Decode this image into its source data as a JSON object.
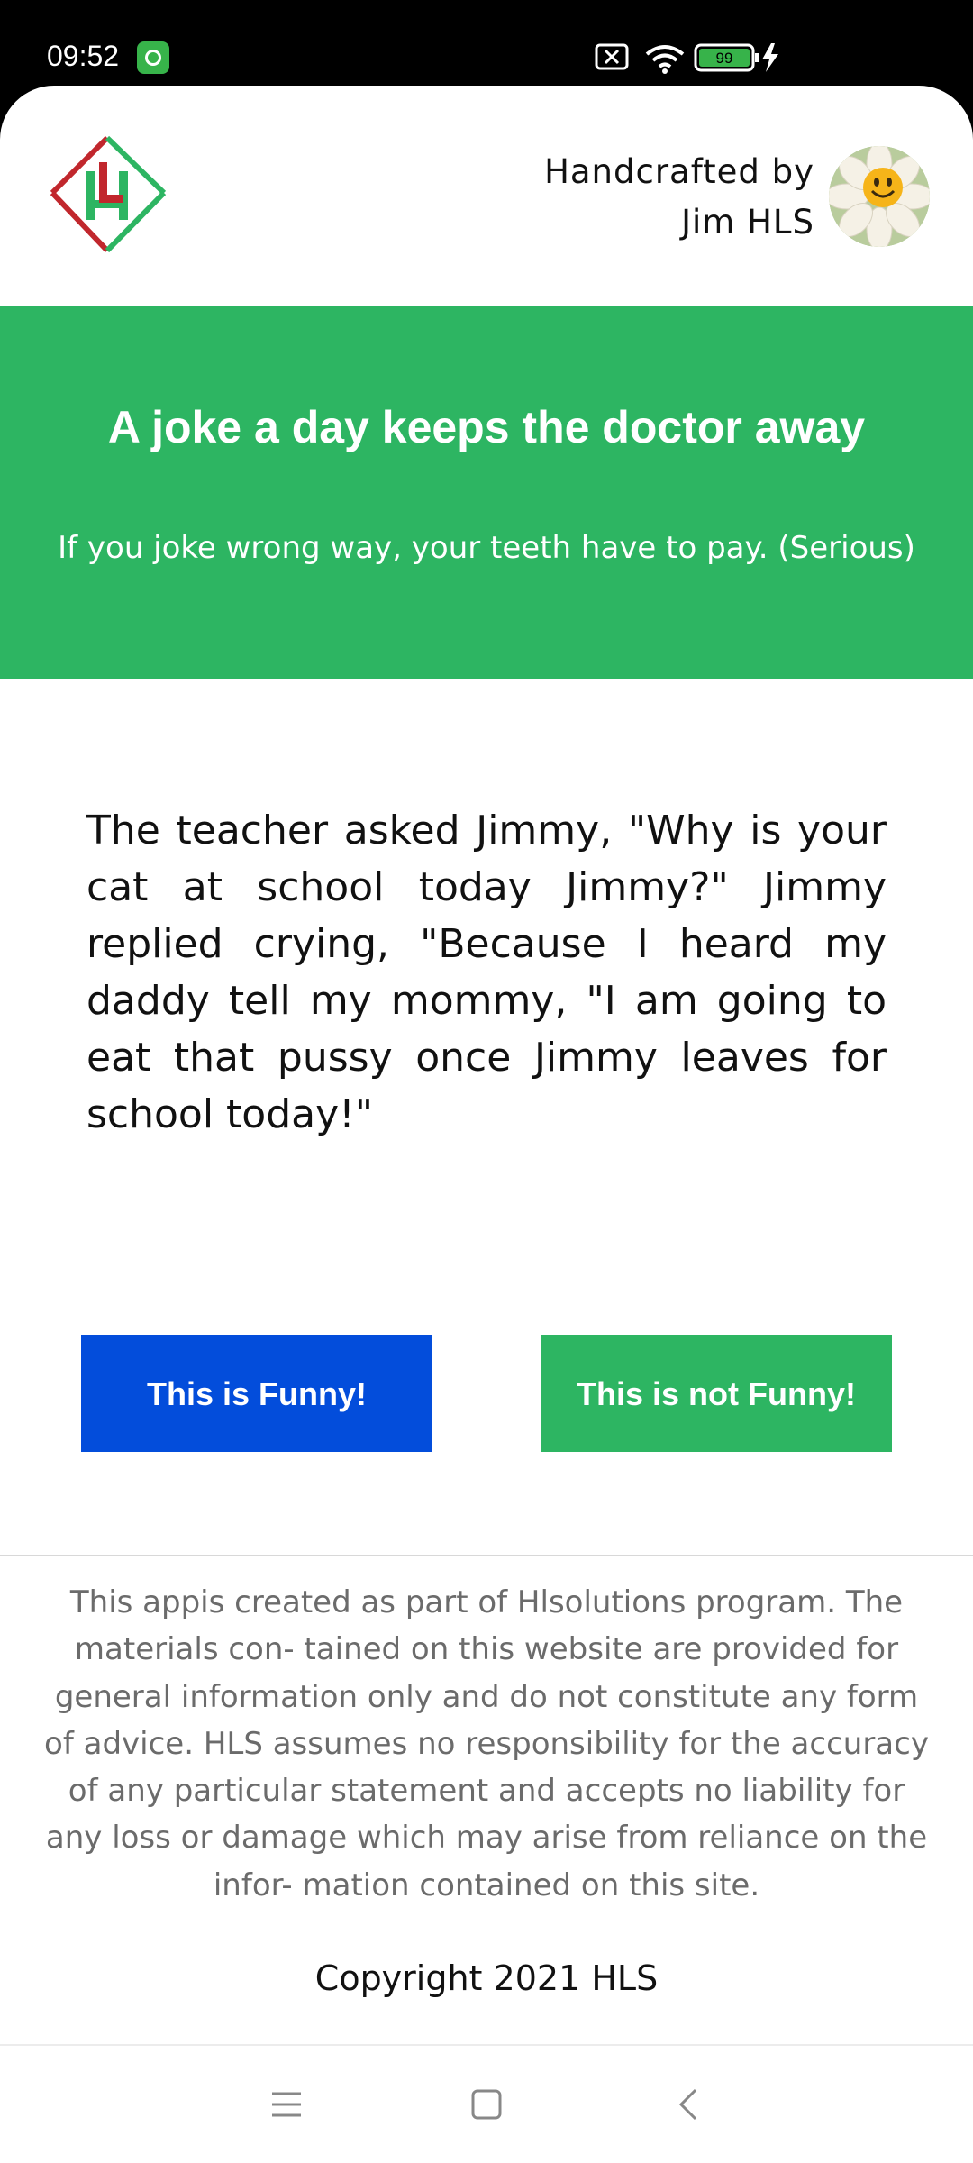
{
  "status_bar": {
    "time": "09:52",
    "battery_level": "99"
  },
  "header": {
    "credit_line1": "Handcrafted by",
    "credit_line2": "Jim HLS",
    "logo_letters": "HL"
  },
  "banner": {
    "title": "A joke a day keeps the doctor away",
    "subtitle": "If you joke wrong way, your teeth have to pay. (Serious)",
    "color": "#2db562"
  },
  "joke": {
    "text": "The teacher asked Jimmy, \"Why is your cat at school today Jimmy?\" Jimmy replied crying, \"Because I heard my daddy tell my mommy, \"I am going to eat that pussy once Jimmy leaves for school today!\""
  },
  "buttons": {
    "funny_label": "This is Funny!",
    "not_funny_label": "This is not Funny!",
    "funny_color": "#034ddb",
    "not_funny_color": "#2db562"
  },
  "footer": {
    "disclaimer": "This appis created as part of Hlsolutions program. The materials con- tained on this website are provided for general information only and do not constitute any form of advice. HLS assumes no responsibility for the accuracy of any particular statement and accepts no liability for any loss or damage which may arise from reliance on the infor- mation contained on this site.",
    "copyright": "Copyright 2021 HLS"
  },
  "nav_bar": {
    "items": [
      "menu-icon",
      "home-icon",
      "back-icon"
    ]
  }
}
